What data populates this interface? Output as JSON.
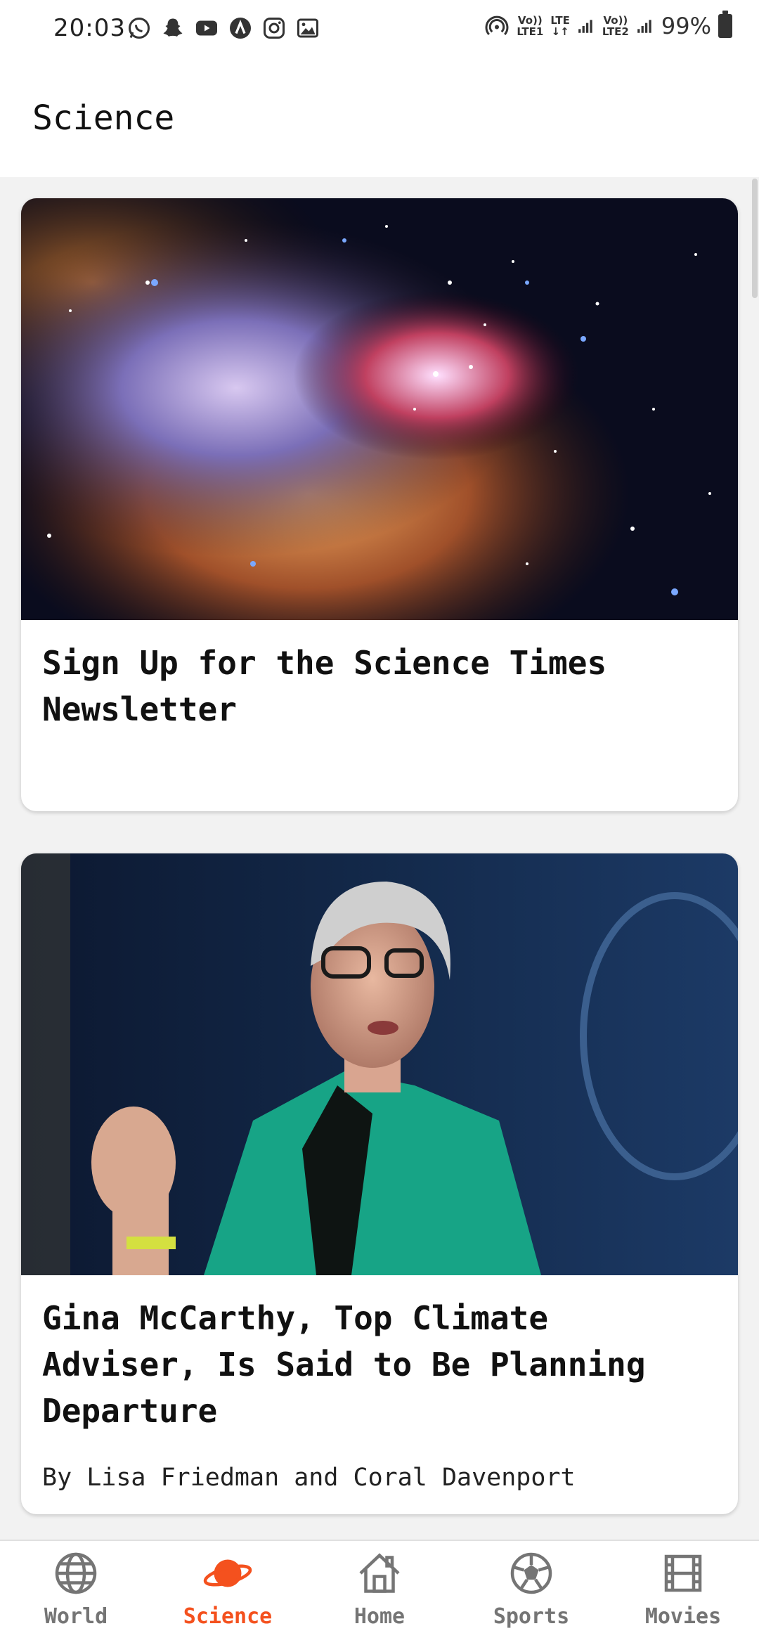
{
  "status_bar": {
    "time": "20:03",
    "net1_top": "Vo))",
    "net1_bottom": "LTE1",
    "net_mid_top": "LTE",
    "net_mid_bottom": "↓↑",
    "net2_top": "Vo))",
    "net2_bottom": "LTE2",
    "battery": "99%",
    "left_icons": [
      "whatsapp-icon",
      "snapchat-icon",
      "youtube-icon",
      "app-a-icon",
      "instagram-icon",
      "gallery-icon"
    ]
  },
  "app_bar": {
    "title": "Science"
  },
  "articles": [
    {
      "headline": "Sign Up for the Science Times Newsletter",
      "byline": "",
      "image": "nebula-star-cluster-photo"
    },
    {
      "headline": "Gina McCarthy, Top Climate Adviser, Is Said to Be Planning Departure",
      "byline": "By Lisa Friedman and Coral Davenport",
      "image": "woman-speaking-at-podium-photo"
    }
  ],
  "bottom_nav": {
    "active": "Science",
    "active_color": "#f4511e",
    "items": [
      {
        "label": "World",
        "icon": "globe-icon"
      },
      {
        "label": "Science",
        "icon": "planet-icon"
      },
      {
        "label": "Home",
        "icon": "home-icon"
      },
      {
        "label": "Sports",
        "icon": "soccer-ball-icon"
      },
      {
        "label": "Movies",
        "icon": "film-icon"
      }
    ]
  }
}
